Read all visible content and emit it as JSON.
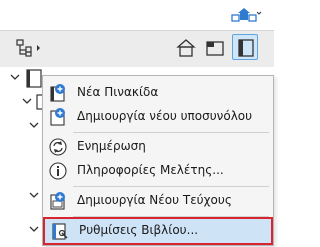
{
  "colors": {
    "selection_fill": "#cfe6f8",
    "selection_border": "#5fa4de",
    "highlight_outline": "#d9232e",
    "icon_blue": "#2f7bd1"
  },
  "toolbar": {
    "icons": [
      "project-map-icon",
      "view-map-icon",
      "layout-book-icon"
    ],
    "selected_view": "layout-book-icon"
  },
  "menu": {
    "items": [
      {
        "label": "Νέα Πινακίδα",
        "icon": "new-layout-icon"
      },
      {
        "label": "Δημιουργία νέου υποσυνόλου",
        "icon": "new-subset-icon"
      },
      {
        "label": "Ενημέρωση",
        "icon": "update-icon"
      },
      {
        "label": "Πληροφορίες Μελέτης...",
        "icon": "info-icon"
      },
      {
        "label": "Δημιουργία Νέου Τεύχους",
        "icon": "new-issue-icon"
      },
      {
        "label": "Ρυθμίσεις Βιβλίου...",
        "icon": "book-settings-icon",
        "highlighted": true
      }
    ]
  }
}
